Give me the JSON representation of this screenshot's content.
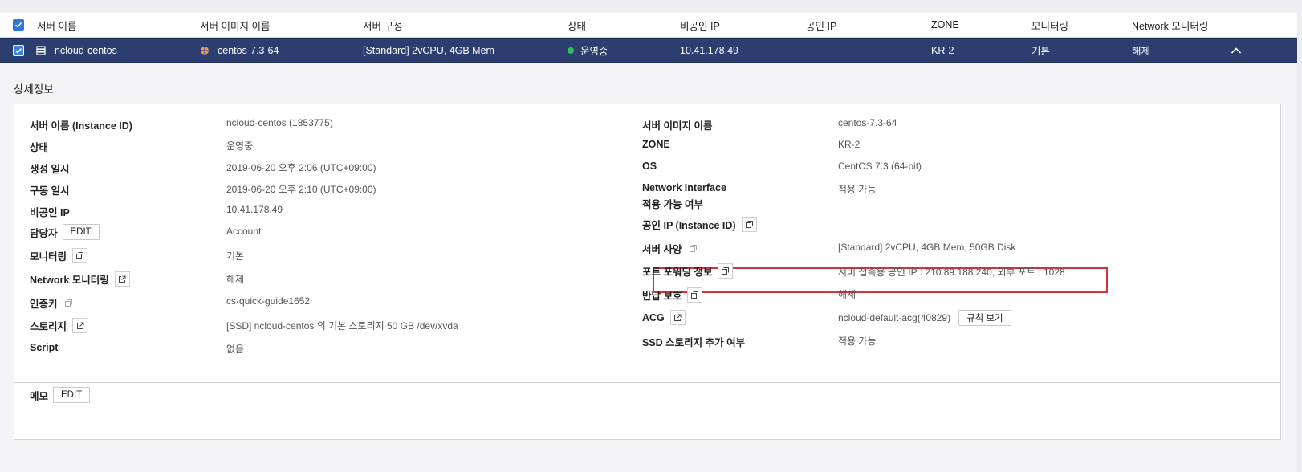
{
  "table": {
    "headers": [
      "서버 이름",
      "서버 이미지 이름",
      "서버 구성",
      "상태",
      "비공인 IP",
      "공인 IP",
      "ZONE",
      "모니터링",
      "Network 모니터링"
    ],
    "row": {
      "name": "ncloud-centos",
      "image": "centos-7.3-64",
      "spec": "[Standard] 2vCPU, 4GB Mem",
      "status": "운영중",
      "private_ip": "10.41.178.49",
      "public_ip": "",
      "zone": "KR-2",
      "monitoring": "기본",
      "network_monitoring": "해제"
    }
  },
  "detail": {
    "title": "상세정보",
    "edit_label": "EDIT",
    "rule_button": "규칙 보기",
    "left": [
      {
        "label": "서버 이름 (Instance ID)",
        "value": "ncloud-centos (1853775)"
      },
      {
        "label": "상태",
        "value": "운영중"
      },
      {
        "label": "생성 일시",
        "value": "2019-06-20 오후 2:06 (UTC+09:00)"
      },
      {
        "label": "구동 일시",
        "value": "2019-06-20 오후 2:10 (UTC+09:00)"
      },
      {
        "label": "비공인 IP",
        "value": "10.41.178.49"
      },
      {
        "label": "담당자",
        "value": "Account"
      },
      {
        "label": "모니터링",
        "value": "기본"
      },
      {
        "label": "Network 모니터링",
        "value": "해제"
      },
      {
        "label": "인증키",
        "value": "cs-quick-guide1652"
      },
      {
        "label": "스토리지",
        "value": "[SSD] ncloud-centos 의 기본 스토리지  50 GB /dev/xvda"
      },
      {
        "label": "Script",
        "value": "없음"
      }
    ],
    "right": [
      {
        "label": "서버 이미지 이름",
        "value": "centos-7.3-64"
      },
      {
        "label": "ZONE",
        "value": "KR-2"
      },
      {
        "label": "OS",
        "value": "CentOS 7.3 (64-bit)"
      },
      {
        "label": "Network Interface",
        "label2": "적용 가능 여부",
        "value": "적용 가능"
      },
      {
        "label": "공인 IP (Instance ID)",
        "value": ""
      },
      {
        "label": "서버 사양",
        "value": "[Standard] 2vCPU, 4GB Mem, 50GB Disk"
      },
      {
        "label": "포트 포워딩 정보",
        "value": "서버 접속용 공인 IP : 210.89.188.240, 외부 포트 : 1028"
      },
      {
        "label": "반납 보호",
        "value": "해제"
      },
      {
        "label": "ACG",
        "value": "ncloud-default-acg(40829)"
      },
      {
        "label": "SSD 스토리지 추가 여부",
        "value": "적용 가능"
      }
    ]
  },
  "memo": {
    "label": "메모",
    "edit_label": "EDIT"
  },
  "icons": {
    "check": "check-icon",
    "server": "server-icon",
    "os": "centos-logo-icon",
    "collapse": "chevron-up-icon",
    "copy": "copy-icon",
    "external": "external-link-icon"
  },
  "colors": {
    "selected_row": "#2c3e6f",
    "checkbox": "#2c78d6",
    "running": "#2fbf5c",
    "highlight": "#d6313a"
  }
}
